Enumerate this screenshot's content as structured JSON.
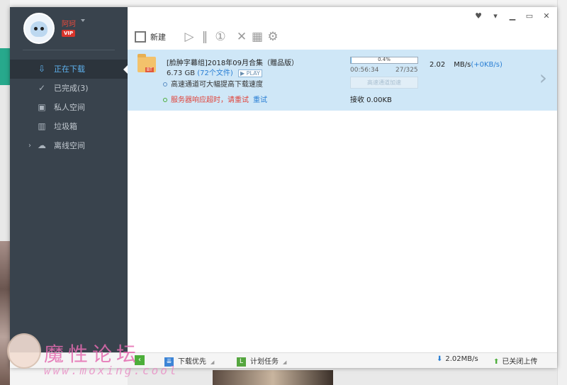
{
  "sidebar": {
    "username": "阿珂",
    "vip": "VIP",
    "nav": [
      {
        "label": "正在下载"
      },
      {
        "label": "已完成(3)"
      },
      {
        "label": "私人空间"
      },
      {
        "label": "垃圾箱"
      },
      {
        "label": "离线空间"
      }
    ]
  },
  "toolbar": {
    "new_label": "新建"
  },
  "task": {
    "name": "[脸肿字幕组]2018年09月合集（赠品版）",
    "size": "6.73 GB",
    "files": "(72个文件)",
    "play": "PLAY",
    "progress_label": "0.4%",
    "progress": 0.004,
    "elapsed": "00:56:34",
    "pieces": "27/325",
    "accel_button": "高速通道加速",
    "received": "接收 0.00KB",
    "speed": "2.02",
    "speed_unit": "MB/s",
    "speed_extra": "(+0KB/s)",
    "hint_fast": "高速通道可大幅提高下载速度",
    "hint_error": "服务器响应超时，请重试",
    "retry": "重试"
  },
  "statusbar": {
    "priority": "下载优先",
    "plan": "计划任务",
    "down_speed": "2.02MB/s",
    "upload": "已关闭上传"
  },
  "watermark": {
    "text": "魔性论坛",
    "url": "www.moxing.cool"
  }
}
